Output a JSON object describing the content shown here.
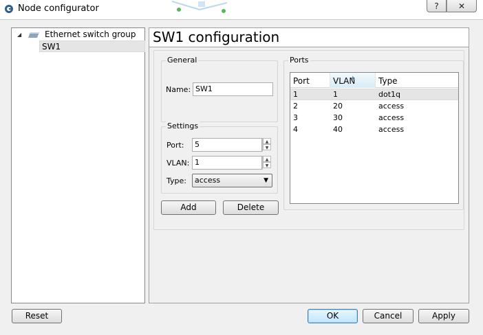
{
  "window": {
    "title": "Node configurator",
    "help_label": "?",
    "close_label": "✕"
  },
  "tree": {
    "group_label": "Ethernet switch group",
    "selected_item": "SW1"
  },
  "panel": {
    "title": "SW1 configuration"
  },
  "general": {
    "title": "General",
    "name_label": "Name:",
    "name_value": "SW1"
  },
  "settings": {
    "title": "Settings",
    "port_label": "Port:",
    "port_value": "5",
    "vlan_label": "VLAN:",
    "vlan_value": "1",
    "type_label": "Type:",
    "type_value": "access"
  },
  "actions": {
    "add_label": "Add",
    "delete_label": "Delete"
  },
  "ports": {
    "title": "Ports",
    "columns": [
      "Port",
      "VLAN",
      "Type"
    ],
    "sorted_column": "VLAN",
    "rows": [
      {
        "port": "1",
        "vlan": "1",
        "type": "dot1q"
      },
      {
        "port": "2",
        "vlan": "20",
        "type": "access"
      },
      {
        "port": "3",
        "vlan": "30",
        "type": "access"
      },
      {
        "port": "4",
        "vlan": "40",
        "type": "access"
      }
    ]
  },
  "footer": {
    "reset_label": "Reset",
    "ok_label": "OK",
    "cancel_label": "Cancel",
    "apply_label": "Apply"
  },
  "icons": {
    "app": "gns3-logo-icon",
    "tree_expand": "expanded-arrow-icon",
    "switch": "ethernet-switch-icon",
    "spin": "spin-arrows-icon",
    "combo": "dropdown-arrow-icon"
  }
}
